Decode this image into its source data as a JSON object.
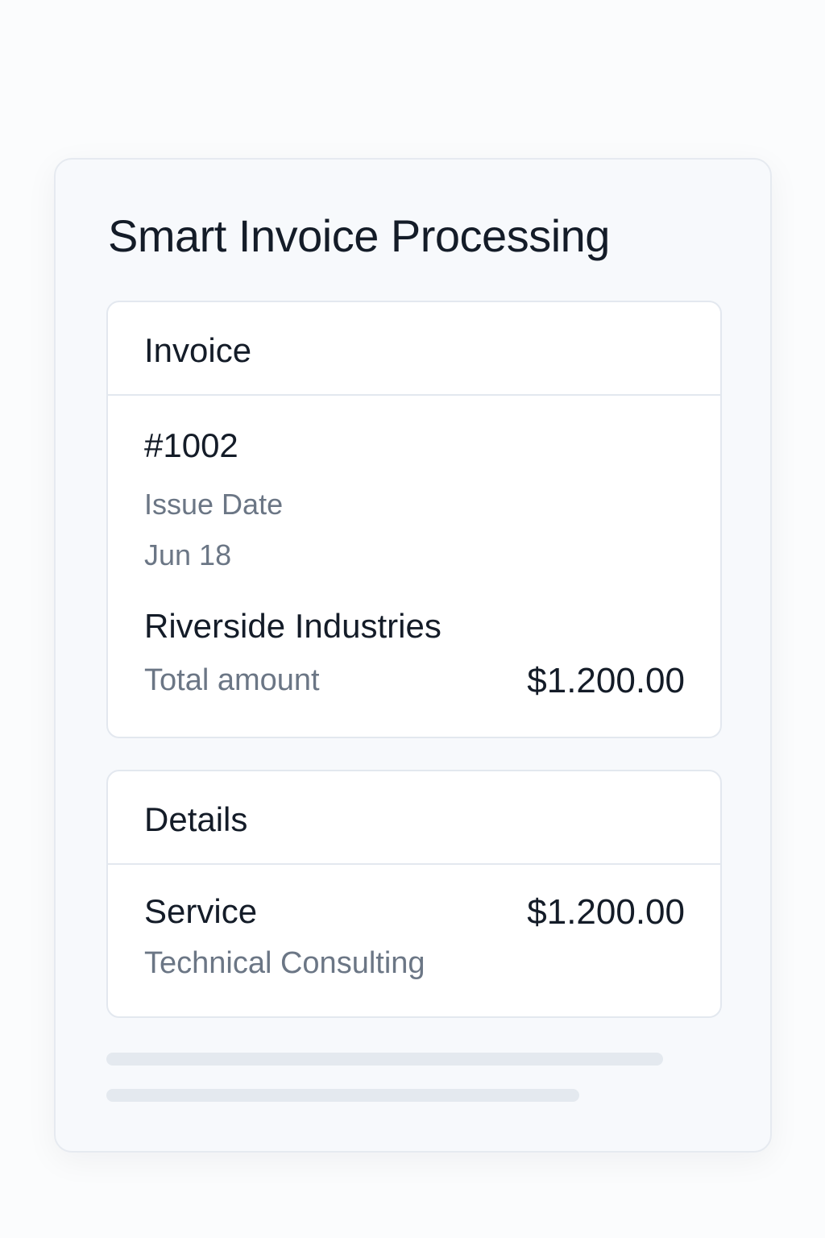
{
  "page": {
    "title": "Smart Invoice Processing"
  },
  "invoice": {
    "header": "Invoice",
    "number": "#1002",
    "issue_date_label": "Issue Date",
    "issue_date_value": "Jun 18",
    "client": "Riverside Industries",
    "total_label": "Total amount",
    "total_value": "$1.200.00"
  },
  "details": {
    "header": "Details",
    "item_label": "Service",
    "item_amount": "$1.200.00",
    "item_description": "Technical Consulting"
  },
  "colors": {
    "background": "#fbfcfd",
    "card": "#f7f9fc",
    "panel": "#ffffff",
    "border": "#e3e8ef",
    "text_primary": "#141c28",
    "text_muted": "#6b7685",
    "skeleton": "#e4e9ef"
  }
}
